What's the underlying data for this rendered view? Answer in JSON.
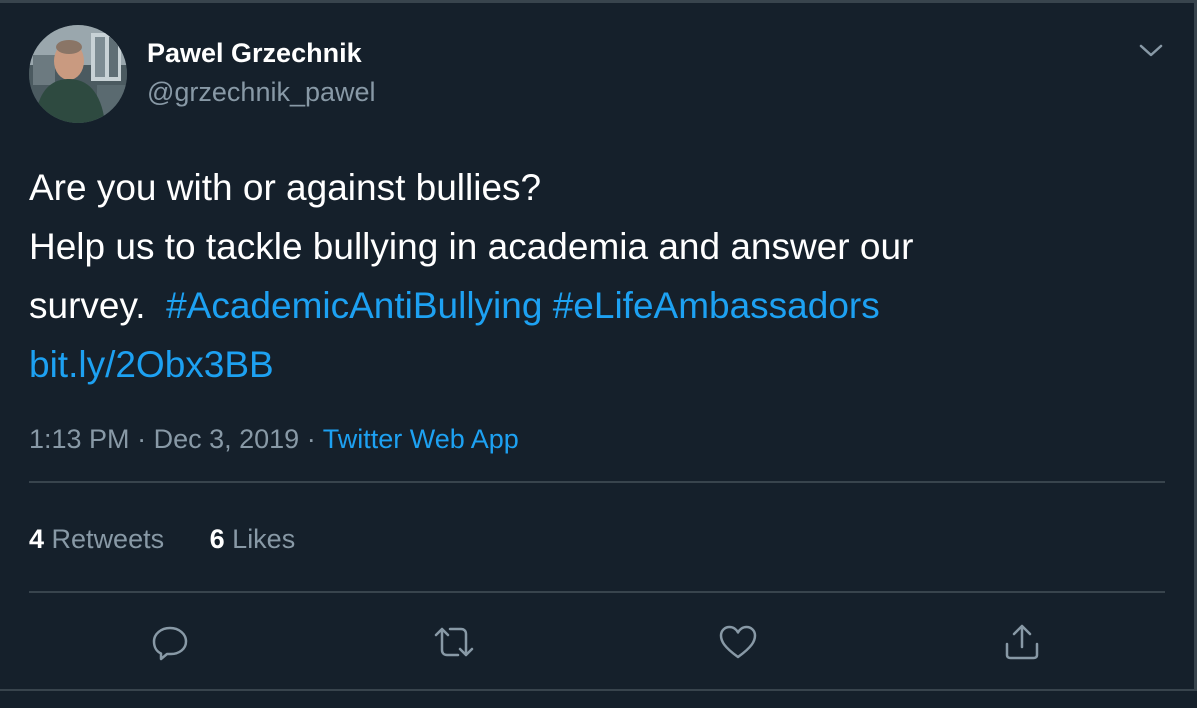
{
  "user": {
    "name": "Pawel Grzechnik",
    "handle": "@grzechnik_pawel"
  },
  "tweet": {
    "line1": "Are you with or against bullies?",
    "line2": "Help us to tackle bullying in academia and answer our",
    "line3_text": "survey.",
    "hashtag1": "#AcademicAntiBullying",
    "hashtag2": "#eLifeAmbassadors",
    "link": "bit.ly/2Obx3BB"
  },
  "meta": {
    "time": "1:13 PM",
    "date": "Dec 3, 2019",
    "source": "Twitter Web App"
  },
  "stats": {
    "retweets_count": "4",
    "retweets_label": "Retweets",
    "likes_count": "6",
    "likes_label": "Likes"
  },
  "icons": {
    "caret": "chevron-down-icon",
    "reply": "reply-icon",
    "retweet": "retweet-icon",
    "like": "heart-icon",
    "share": "share-icon"
  },
  "colors": {
    "background": "#15202b",
    "accent": "#1da1f2",
    "secondary_text": "#8899a6",
    "divider": "#38444d"
  }
}
